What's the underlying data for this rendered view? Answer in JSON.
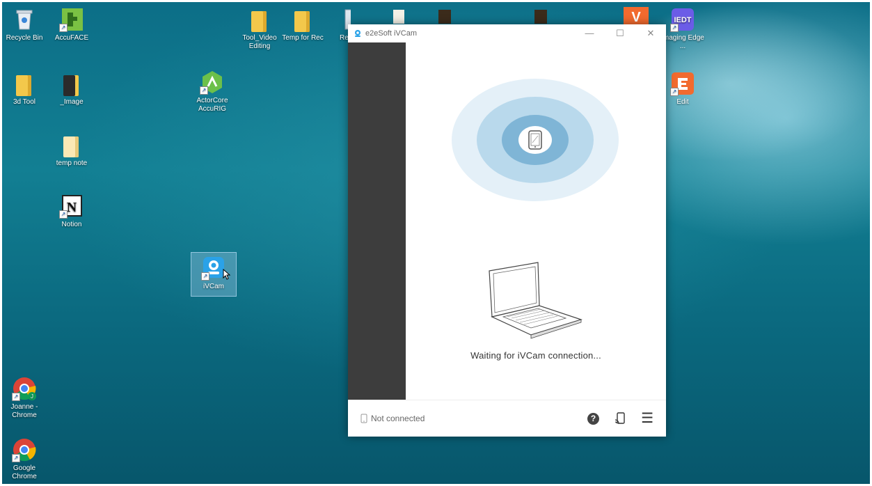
{
  "desktop": {
    "icons": [
      {
        "label": "Recycle Bin"
      },
      {
        "label": "AccuFACE"
      },
      {
        "label": "3d Tool"
      },
      {
        "label": "_Image"
      },
      {
        "label": "temp note"
      },
      {
        "label": "Notion"
      },
      {
        "label": "ActorCore AccuRIG"
      },
      {
        "label": "iVCam"
      },
      {
        "label": "Tool_Video Editing"
      },
      {
        "label": "Temp for Rec"
      },
      {
        "label": "Re"
      },
      {
        "label": "Imaging Edge ..."
      },
      {
        "label": "Edit"
      },
      {
        "label": "Joanne - Chrome"
      },
      {
        "label": "Google Chrome"
      }
    ]
  },
  "window": {
    "title": "e2eSoft iVCam",
    "minimize": "—",
    "maximize": "☐",
    "close": "✕",
    "waiting_text": "Waiting for iVCam connection...",
    "status": "Not connected",
    "help_glyph": "?",
    "menu_glyph": "☰"
  },
  "colors": {
    "accent": "#2aa2e8",
    "ripple_outer": "#e4f0f8",
    "ripple_mid": "#b9d9ec",
    "ripple_inner": "#7fb5d6",
    "sidebar": "#3d3d3d"
  }
}
